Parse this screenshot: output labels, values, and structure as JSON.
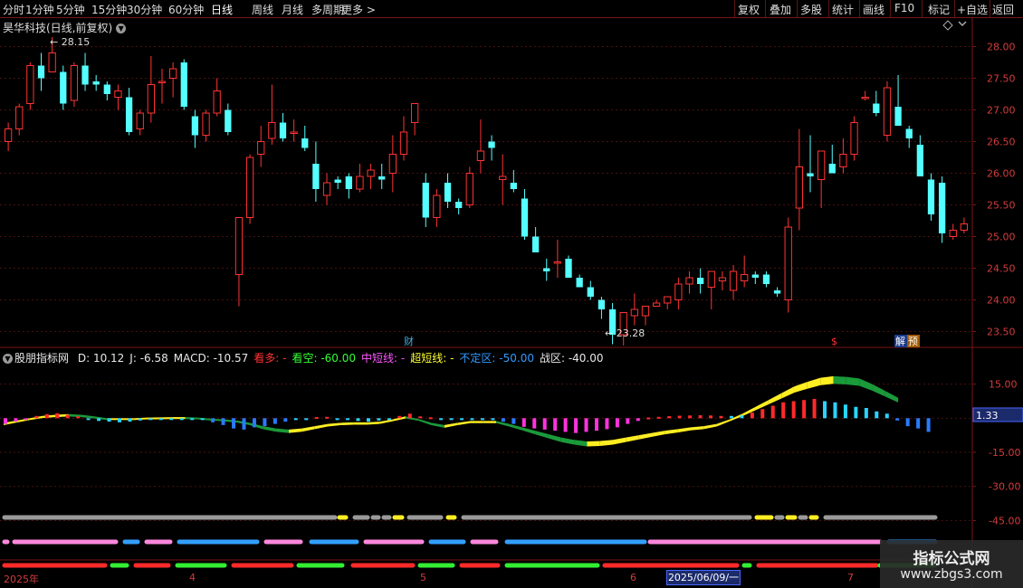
{
  "toolbar": {
    "periods": [
      "分时",
      "1分钟",
      "5分钟",
      "15分钟",
      "30分钟",
      "60分钟",
      "日线",
      "周线",
      "月线",
      "多周期",
      "更多 >"
    ],
    "active_period": "日线",
    "tools": [
      "复权",
      "叠加",
      "多股",
      "统计",
      "画线",
      "F10",
      "标记",
      "+自选",
      "返回"
    ]
  },
  "stock": {
    "title": "昊华科技(日线,前复权)",
    "collapse_icon": "chevron-down-icon"
  },
  "price_axis": {
    "ticks": [
      "28.00",
      "27.50",
      "27.00",
      "26.50",
      "26.00",
      "25.50",
      "25.00",
      "24.50",
      "24.00",
      "23.50"
    ]
  },
  "annotations": {
    "high_label": "28.15",
    "low_label": "23.28",
    "cai": "财",
    "s_mark": "$",
    "jie": "解",
    "yu": "预"
  },
  "indicator": {
    "name": "股朋指标网",
    "items": [
      {
        "label": "D: 10.12",
        "color": "#e8e8e8"
      },
      {
        "label": "J: -6.58",
        "color": "#e8e8e8"
      },
      {
        "label": "MACD: -10.57",
        "color": "#e8e8e8"
      },
      {
        "label": "看多: -",
        "color": "#ff3333"
      },
      {
        "label": "看空: -60.00",
        "color": "#33ff33"
      },
      {
        "label": "中短线: -",
        "color": "#ff55ff"
      },
      {
        "label": "超短线: -",
        "color": "#ffff33"
      },
      {
        "label": "不定区: -50.00",
        "color": "#3399ff"
      },
      {
        "label": "战区: -40.00",
        "color": "#e8e8e8"
      }
    ],
    "axis_ticks": [
      "15.00",
      "0.00",
      "-15.00",
      "-30.00",
      "-45.00"
    ],
    "current_value": "1.33"
  },
  "dates": {
    "year": "2025年",
    "m4": "4",
    "m5": "5",
    "m6": "6",
    "m7": "7",
    "cursor_date": "2025/06/09/一"
  },
  "watermark": {
    "line1": "指标公式网",
    "line2": "www.zbgs3.com"
  },
  "colors": {
    "up": "#ff3333",
    "down": "#54ffff",
    "grid": "#5a1414",
    "axis_text": "#d23c3c"
  },
  "chart_data": {
    "type": "candlestick",
    "series_order": "open,high,low,close",
    "candles": [
      [
        26.5,
        26.8,
        26.35,
        26.7
      ],
      [
        26.7,
        27.1,
        26.6,
        27.05
      ],
      [
        27.1,
        27.75,
        27.0,
        27.7
      ],
      [
        27.7,
        27.9,
        27.3,
        27.5
      ],
      [
        27.6,
        28.15,
        27.6,
        27.9
      ],
      [
        27.6,
        27.7,
        27.0,
        27.1
      ],
      [
        27.15,
        27.75,
        27.05,
        27.7
      ],
      [
        27.7,
        27.9,
        27.3,
        27.4
      ],
      [
        27.45,
        27.55,
        27.3,
        27.4
      ],
      [
        27.4,
        27.45,
        27.15,
        27.25
      ],
      [
        27.2,
        27.4,
        27.0,
        27.3
      ],
      [
        27.2,
        27.35,
        26.6,
        26.65
      ],
      [
        26.7,
        27.0,
        26.6,
        26.95
      ],
      [
        26.95,
        27.85,
        26.8,
        27.4
      ],
      [
        27.45,
        27.65,
        27.1,
        27.45
      ],
      [
        27.5,
        27.75,
        27.2,
        27.65
      ],
      [
        27.75,
        27.8,
        27.0,
        27.05
      ],
      [
        26.9,
        27.0,
        26.4,
        26.6
      ],
      [
        26.6,
        27.0,
        26.5,
        26.95
      ],
      [
        26.95,
        27.5,
        26.9,
        27.3
      ],
      [
        27.0,
        27.1,
        26.6,
        26.65
      ],
      [
        24.4,
        24.9,
        23.9,
        25.3
      ],
      [
        25.3,
        26.3,
        25.2,
        26.25
      ],
      [
        26.3,
        26.75,
        26.1,
        26.5
      ],
      [
        26.55,
        27.4,
        26.45,
        26.8
      ],
      [
        26.8,
        26.95,
        26.5,
        26.55
      ],
      [
        26.65,
        26.85,
        26.5,
        26.65
      ],
      [
        26.55,
        26.75,
        26.35,
        26.4
      ],
      [
        26.15,
        26.5,
        25.55,
        25.75
      ],
      [
        25.65,
        26.0,
        25.5,
        25.85
      ],
      [
        25.9,
        25.95,
        25.75,
        25.85
      ],
      [
        25.95,
        26.0,
        25.6,
        25.75
      ],
      [
        25.75,
        26.15,
        25.7,
        25.95
      ],
      [
        25.95,
        26.15,
        25.75,
        26.05
      ],
      [
        25.95,
        26.15,
        25.75,
        25.9
      ],
      [
        26.0,
        26.6,
        25.7,
        26.3
      ],
      [
        26.3,
        26.9,
        26.2,
        26.65
      ],
      [
        26.8,
        27.05,
        26.6,
        27.1
      ],
      [
        25.85,
        26.0,
        25.15,
        25.3
      ],
      [
        25.3,
        25.75,
        25.15,
        25.65
      ],
      [
        25.85,
        26.0,
        25.45,
        25.55
      ],
      [
        25.55,
        25.6,
        25.35,
        25.45
      ],
      [
        25.5,
        26.1,
        25.45,
        26.0
      ],
      [
        26.2,
        26.85,
        26.0,
        26.35
      ],
      [
        26.5,
        26.6,
        26.2,
        26.4
      ],
      [
        25.9,
        26.3,
        25.5,
        25.95
      ],
      [
        25.85,
        26.05,
        25.7,
        25.75
      ],
      [
        25.6,
        25.75,
        24.95,
        25.0
      ],
      [
        25.0,
        25.15,
        24.75,
        24.75
      ],
      [
        24.5,
        24.65,
        24.3,
        24.45
      ],
      [
        24.6,
        24.95,
        24.35,
        24.6
      ],
      [
        24.65,
        24.7,
        24.4,
        24.35
      ],
      [
        24.35,
        24.4,
        24.2,
        24.2
      ],
      [
        24.2,
        24.3,
        24.0,
        24.05
      ],
      [
        24.0,
        24.05,
        23.7,
        23.85
      ],
      [
        23.85,
        23.95,
        23.3,
        23.45
      ],
      [
        23.45,
        23.8,
        23.28,
        23.8
      ],
      [
        23.75,
        24.1,
        23.6,
        23.85
      ],
      [
        23.75,
        23.9,
        23.6,
        23.9
      ],
      [
        23.9,
        24.0,
        23.9,
        23.95
      ],
      [
        23.95,
        24.05,
        23.85,
        24.05
      ],
      [
        24.0,
        24.35,
        23.85,
        24.25
      ],
      [
        24.25,
        24.45,
        24.1,
        24.35
      ],
      [
        24.35,
        24.5,
        24.1,
        24.25
      ],
      [
        24.2,
        24.45,
        23.85,
        24.45
      ],
      [
        24.3,
        24.45,
        24.15,
        24.35
      ],
      [
        24.15,
        24.55,
        24.0,
        24.45
      ],
      [
        24.3,
        24.7,
        24.2,
        24.4
      ],
      [
        24.4,
        24.45,
        24.25,
        24.35
      ],
      [
        24.4,
        24.45,
        24.2,
        24.25
      ],
      [
        24.15,
        24.2,
        24.05,
        24.1
      ],
      [
        24.0,
        25.3,
        23.8,
        25.15
      ],
      [
        25.45,
        26.7,
        25.1,
        26.1
      ],
      [
        26.0,
        26.6,
        25.7,
        25.95
      ],
      [
        25.9,
        26.35,
        25.45,
        26.35
      ],
      [
        26.15,
        26.45,
        26.0,
        26.0
      ],
      [
        26.1,
        26.55,
        26.0,
        26.3
      ],
      [
        26.3,
        26.9,
        26.2,
        26.8
      ],
      [
        27.2,
        27.3,
        27.15,
        27.2
      ],
      [
        27.1,
        27.3,
        26.9,
        26.95
      ],
      [
        26.6,
        27.45,
        26.5,
        27.35
      ],
      [
        27.05,
        27.55,
        26.75,
        26.75
      ],
      [
        26.7,
        26.75,
        26.4,
        26.55
      ],
      [
        26.45,
        26.6,
        26.0,
        25.95
      ],
      [
        25.9,
        26.0,
        25.25,
        25.35
      ],
      [
        25.85,
        25.95,
        24.9,
        25.05
      ],
      [
        25.0,
        25.2,
        24.95,
        25.1
      ],
      [
        25.1,
        25.3,
        25.05,
        25.2
      ]
    ],
    "price_range": [
      23.25,
      28.45
    ],
    "histogram": [
      -2.5,
      -1.5,
      -0.5,
      1.0,
      1.8,
      2.2,
      1.5,
      0.8,
      -0.5,
      -1.2,
      -1.5,
      -1.8,
      -1.5,
      -1.0,
      -0.6,
      -0.3,
      -0.2,
      -0.2,
      -0.5,
      -0.8,
      -1.8,
      -3.0,
      -4.5,
      -5.0,
      -4.0,
      -3.5,
      -2.5,
      -1.5,
      -0.8,
      -0.4,
      0.5,
      0.6,
      -0.5,
      -0.8,
      -1.2,
      -1.5,
      -1.0,
      -0.5,
      1.0,
      2.0,
      0.8,
      0.4,
      -0.2,
      -0.4,
      -0.6,
      -0.4,
      -0.2,
      -0.3,
      -1.5,
      -2.5,
      -3.8,
      -4.5,
      -5.0,
      -5.5,
      -6.0,
      -6.5,
      -6.0,
      -5.5,
      -4.8,
      -4.0,
      -2.5,
      -1.2,
      0.3,
      0.6,
      0.9,
      1.1,
      1.2,
      1.3,
      1.2,
      1.0,
      1.0,
      1.2,
      2.5,
      4.0,
      5.5,
      7.0,
      7.5,
      8.0,
      8.5,
      7.5,
      7.0,
      6.0,
      5.0,
      4.5,
      3.0,
      2.0,
      -1.0,
      -3.5,
      -4.5,
      -6.0
    ],
    "hist_colors": [
      "m",
      "m",
      "m",
      "r",
      "r",
      "r",
      "r",
      "r",
      "c",
      "c",
      "c",
      "c",
      "c",
      "c",
      "c",
      "c",
      "c",
      "c",
      "c",
      "c",
      "b",
      "b",
      "b",
      "b",
      "b",
      "b",
      "b",
      "b",
      "c",
      "c",
      "r",
      "r",
      "c",
      "c",
      "c",
      "c",
      "c",
      "c",
      "r",
      "r",
      "r",
      "r",
      "c",
      "c",
      "c",
      "c",
      "c",
      "c",
      "b",
      "b",
      "m",
      "m",
      "m",
      "m",
      "m",
      "m",
      "m",
      "m",
      "m",
      "m",
      "m",
      "m",
      "r",
      "r",
      "r",
      "r",
      "r",
      "r",
      "r",
      "r",
      "c",
      "c",
      "r",
      "r",
      "r",
      "r",
      "r",
      "r",
      "r",
      "c",
      "c",
      "c",
      "c",
      "c",
      "c",
      "c",
      "b",
      "b",
      "b",
      "b"
    ],
    "band_upper": [
      -2,
      -1,
      0,
      1,
      1.5,
      1.8,
      1.5,
      0.8,
      0,
      0,
      0,
      0.3,
      0.4,
      0.5,
      0.5,
      0.3,
      -0.2,
      -0.5,
      -1,
      -2,
      -3.5,
      -4.5,
      -5,
      -4.5,
      -3.5,
      -2.5,
      -2,
      -1.8,
      -1.8,
      -1.5,
      -0.5,
      0.8,
      -0.3,
      -2,
      -3,
      -2,
      -1.2,
      -1.2,
      -1.2,
      -2.5,
      -4,
      -5.5,
      -7,
      -8.5,
      -9.5,
      -10.2,
      -10,
      -9.5,
      -8.5,
      -7.5,
      -6.5,
      -5.5,
      -4.8,
      -4,
      -3.5,
      -2.5,
      -0.5,
      2,
      5,
      8,
      11,
      14,
      16,
      17.8,
      18.5,
      18.2,
      17.5,
      15,
      12,
      9
    ],
    "ind_range": [
      -48,
      24
    ]
  }
}
